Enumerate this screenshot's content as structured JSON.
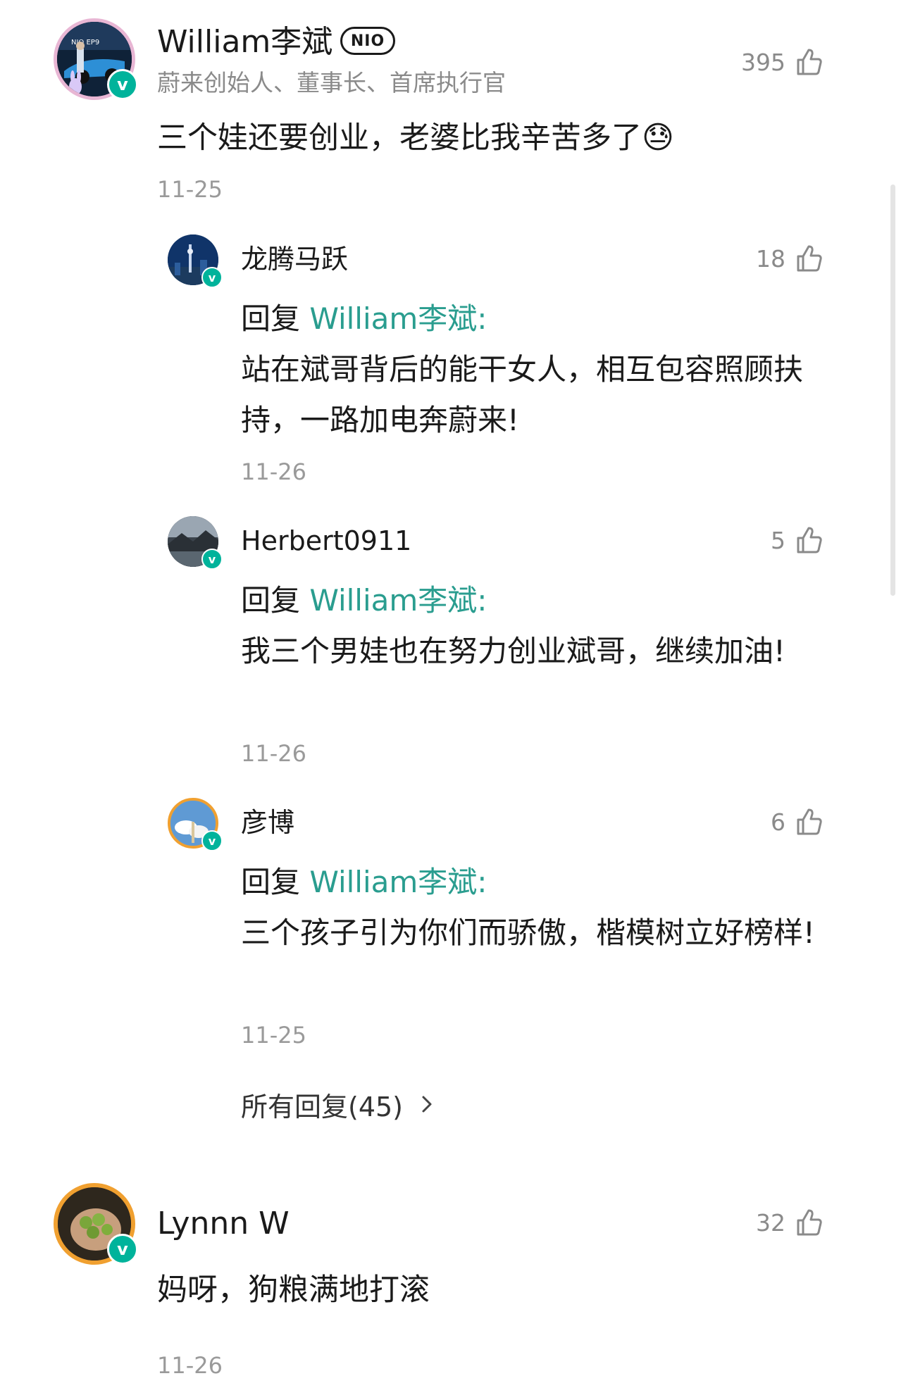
{
  "main_comment": {
    "author": "William李斌",
    "badge": "NIO",
    "title": "蔚来创始人、董事长、首席执行官",
    "likes": "395",
    "text": "三个娃还要创业，老婆比我辛苦多了",
    "emoji": "😓",
    "date": "11-25",
    "avatar_badge": "v",
    "avatar_caption": "NIO EP9"
  },
  "replies": [
    {
      "author": "龙腾马跃",
      "likes": "18",
      "reply_prefix": "回复 ",
      "reply_to": "William李斌:",
      "text": "站在斌哥背后的能干女人，相互包容照顾扶持，一路加电奔蔚来!",
      "date": "11-26",
      "avatar_badge": "v"
    },
    {
      "author": "Herbert0911",
      "likes": "5",
      "reply_prefix": "回复 ",
      "reply_to": "William李斌:",
      "text": "我三个男娃也在努力创业斌哥，继续加油!",
      "date": "11-26",
      "avatar_badge": "v"
    },
    {
      "author": "彦博",
      "likes": "6",
      "reply_prefix": "回复 ",
      "reply_to": "William李斌:",
      "text": "三个孩子引为你们而骄傲，楷模树立好榜样!",
      "date": "11-25",
      "avatar_badge": "v"
    }
  ],
  "all_replies_label": "所有回复(45)",
  "second_comment": {
    "author": "Lynnn W",
    "likes": "32",
    "text": "妈呀，狗粮满地打滚",
    "date": "11-26",
    "avatar_badge": "v"
  },
  "colors": {
    "reply_link": "#2a9d8f",
    "verified_badge": "#00b39b",
    "muted_text": "#8a8a8a"
  }
}
